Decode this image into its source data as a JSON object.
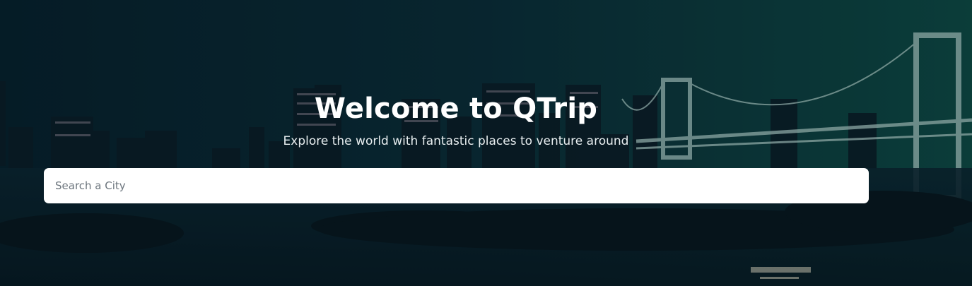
{
  "hero": {
    "title": "Welcome to QTrip",
    "subtitle": "Explore the world with fantastic places to venture around",
    "background_image": "night-city-skyline-with-bridge"
  },
  "search": {
    "placeholder": "Search a City",
    "value": ""
  },
  "colors": {
    "overlay_dark": "#071c28",
    "overlay_teal": "#0d4a44",
    "text_primary": "#ffffff",
    "input_bg": "#ffffff",
    "placeholder": "#6c757d"
  }
}
